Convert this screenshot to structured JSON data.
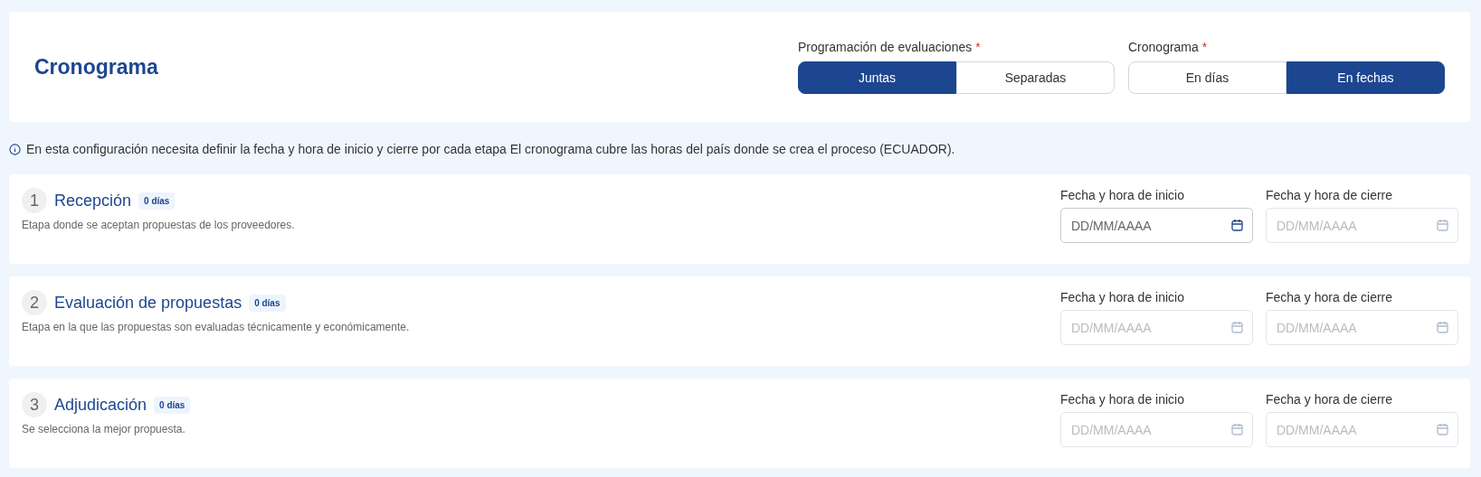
{
  "header": {
    "title": "Cronograma",
    "toggles": [
      {
        "label": "Programación de evaluaciones",
        "required_mark": "*",
        "options": [
          {
            "label": "Juntas",
            "selected": true
          },
          {
            "label": "Separadas",
            "selected": false
          }
        ]
      },
      {
        "label": "Cronograma",
        "required_mark": "*",
        "options": [
          {
            "label": "En días",
            "selected": false
          },
          {
            "label": "En fechas",
            "selected": true
          }
        ]
      }
    ]
  },
  "info": "En esta configuración necesita definir la fecha y hora de inicio y cierre por cada etapa El cronograma cubre las horas del país donde se crea el proceso (ECUADOR).",
  "stages": [
    {
      "number": "1",
      "name": "Recepción",
      "badge": "0 días",
      "description": "Etapa donde se aceptan propuestas de los proveedores.",
      "fields": [
        {
          "label": "Fecha y hora de inicio",
          "placeholder": "DD/MM/AAAA",
          "disabled": false
        },
        {
          "label": "Fecha y hora de cierre",
          "placeholder": "DD/MM/AAAA",
          "disabled": true
        }
      ]
    },
    {
      "number": "2",
      "name": "Evaluación de propuestas",
      "badge": "0 días",
      "description": "Etapa en la que las propuestas son evaluadas técnicamente y económicamente.",
      "fields": [
        {
          "label": "Fecha y hora de inicio",
          "placeholder": "DD/MM/AAAA",
          "disabled": true
        },
        {
          "label": "Fecha y hora de cierre",
          "placeholder": "DD/MM/AAAA",
          "disabled": true
        }
      ]
    },
    {
      "number": "3",
      "name": "Adjudicación",
      "badge": "0 días",
      "description": "Se selecciona la mejor propuesta.",
      "fields": [
        {
          "label": "Fecha y hora de inicio",
          "placeholder": "DD/MM/AAAA",
          "disabled": true
        },
        {
          "label": "Fecha y hora de cierre",
          "placeholder": "DD/MM/AAAA",
          "disabled": true
        }
      ]
    }
  ]
}
